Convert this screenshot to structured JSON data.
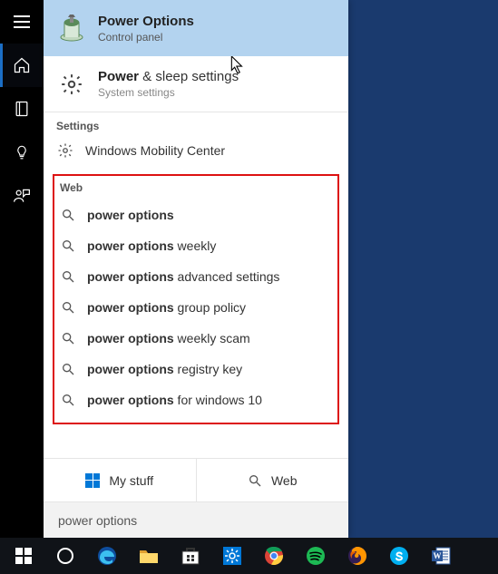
{
  "left_rail": {
    "items": [
      "menu",
      "home",
      "screen",
      "bulb",
      "network"
    ]
  },
  "best_match": {
    "title": "Power Options",
    "sub": "Control panel"
  },
  "second_match": {
    "title_bold": "Power",
    "title_rest": " & sleep settings",
    "sub": "System settings"
  },
  "sections": {
    "settings_header": "Settings",
    "mobility_label": "Windows Mobility Center",
    "web_header": "Web"
  },
  "web_results": [
    {
      "bold": "power options",
      "rest": ""
    },
    {
      "bold": "power options",
      "rest": " weekly"
    },
    {
      "bold": "power options",
      "rest": " advanced settings"
    },
    {
      "bold": "power options",
      "rest": " group policy"
    },
    {
      "bold": "power options",
      "rest": " weekly scam"
    },
    {
      "bold": "power options",
      "rest": " registry key"
    },
    {
      "bold": "power options",
      "rest": " for windows 10"
    }
  ],
  "tabs": {
    "my_stuff": "My stuff",
    "web": "Web"
  },
  "search": {
    "value": "power options"
  },
  "taskbar": {
    "items": [
      "start",
      "cortana",
      "edge",
      "file-explorer",
      "store",
      "settings",
      "chrome",
      "spotify",
      "firefox",
      "skype",
      "word"
    ]
  }
}
